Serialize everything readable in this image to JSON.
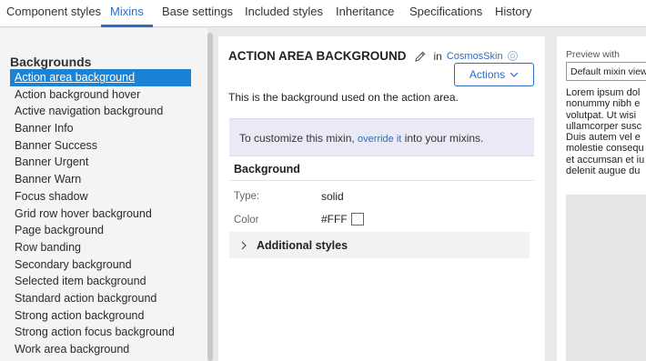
{
  "tabs": [
    {
      "label": "Component styles"
    },
    {
      "label": "Mixins"
    },
    {
      "label": "Base settings"
    },
    {
      "label": "Included styles"
    },
    {
      "label": "Inheritance"
    },
    {
      "label": "Specifications"
    },
    {
      "label": "History"
    }
  ],
  "active_tab": "Mixins",
  "sidebar": {
    "heading": "Backgrounds",
    "items": [
      {
        "label": "Action area background"
      },
      {
        "label": "Action background hover"
      },
      {
        "label": "Active navigation background"
      },
      {
        "label": "Banner Info"
      },
      {
        "label": "Banner Success"
      },
      {
        "label": "Banner Urgent"
      },
      {
        "label": "Banner Warn"
      },
      {
        "label": "Focus shadow"
      },
      {
        "label": "Grid row hover background"
      },
      {
        "label": "Page background"
      },
      {
        "label": "Row banding"
      },
      {
        "label": "Secondary background"
      },
      {
        "label": "Selected item background"
      },
      {
        "label": "Standard action background"
      },
      {
        "label": "Strong action background"
      },
      {
        "label": "Strong action focus background"
      },
      {
        "label": "Work area background"
      }
    ],
    "selected": "Action area background"
  },
  "main": {
    "title": "ACTION AREA BACKGROUND",
    "in_label": "in",
    "skin_name": "CosmosSkin",
    "actions_label": "Actions",
    "description": "This is the background used on the action area.",
    "notice": {
      "prefix": "To customize this mixin,",
      "link": "override it",
      "suffix": "into your mixins."
    },
    "section_title": "Background",
    "properties": {
      "type_label": "Type:",
      "type_value": "solid",
      "color_label": "Color",
      "color_value": "#FFF",
      "swatch_color": "#ffffff"
    },
    "accordion_label": "Additional styles"
  },
  "preview": {
    "label": "Preview with",
    "selected_view": "Default mixin view",
    "text_lines": [
      "Lorem ipsum dol",
      "nonummy nibh e",
      "volutpat. Ut wisi",
      "ullamcorper susc",
      "Duis autem vel e",
      "molestie consequ",
      "et accumsan et iu",
      "delenit augue du"
    ]
  },
  "colors": {
    "accent": "#2a6ec6",
    "selected_bg": "#1a83d6",
    "notice_bg": "#eaeaf7",
    "app_bg": "#e9e9e9"
  }
}
